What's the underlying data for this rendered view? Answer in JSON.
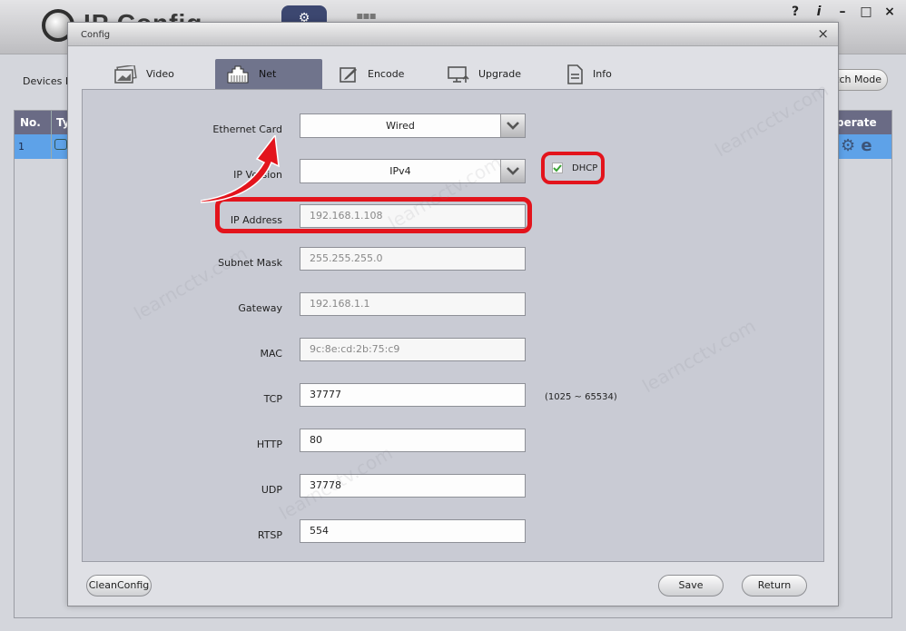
{
  "app": {
    "title": "IP Config",
    "window_controls": [
      "?",
      "i",
      "–",
      "□",
      "×"
    ],
    "devices_label": "Devices F",
    "batch_mode_label": "tch Mode",
    "table": {
      "headers": [
        "No.",
        "Ty",
        "perate"
      ],
      "rows": [
        {
          "no": "1",
          "operate_icons": [
            "gear-icon",
            "e"
          ]
        }
      ]
    }
  },
  "dialog": {
    "title": "Config",
    "close": "×",
    "tabs": [
      {
        "label": "Video",
        "icon": "image-icon"
      },
      {
        "label": "Net",
        "icon": "network-port-icon",
        "active": true
      },
      {
        "label": "Encode",
        "icon": "edit-icon"
      },
      {
        "label": "Upgrade",
        "icon": "monitor-upload-icon"
      },
      {
        "label": "Info",
        "icon": "document-icon"
      }
    ],
    "net": {
      "ethernet_card": {
        "label": "Ethernet Card",
        "value": "Wired"
      },
      "ip_version": {
        "label": "IP Version",
        "value": "IPv4"
      },
      "dhcp": {
        "label": "DHCP",
        "checked": true
      },
      "ip_address": {
        "label": "IP Address",
        "value": "192.168.1.108"
      },
      "subnet_mask": {
        "label": "Subnet Mask",
        "value": "255.255.255.0"
      },
      "gateway": {
        "label": "Gateway",
        "value": "192.168.1.1"
      },
      "mac": {
        "label": "MAC",
        "value": "9c:8e:cd:2b:75:c9"
      },
      "tcp": {
        "label": "TCP",
        "value": "37777",
        "hint": "(1025 ~ 65534)"
      },
      "http": {
        "label": "HTTP",
        "value": "80"
      },
      "udp": {
        "label": "UDP",
        "value": "37778"
      },
      "rtsp": {
        "label": "RTSP",
        "value": "554"
      }
    },
    "buttons": {
      "clean_config": "CleanConfig",
      "save": "Save",
      "return": "Return"
    }
  },
  "colors": {
    "highlight": "#e3141c",
    "selected_row": "#5ea2e8",
    "active_tab": "#70748c"
  },
  "watermark": "learncctv.com"
}
